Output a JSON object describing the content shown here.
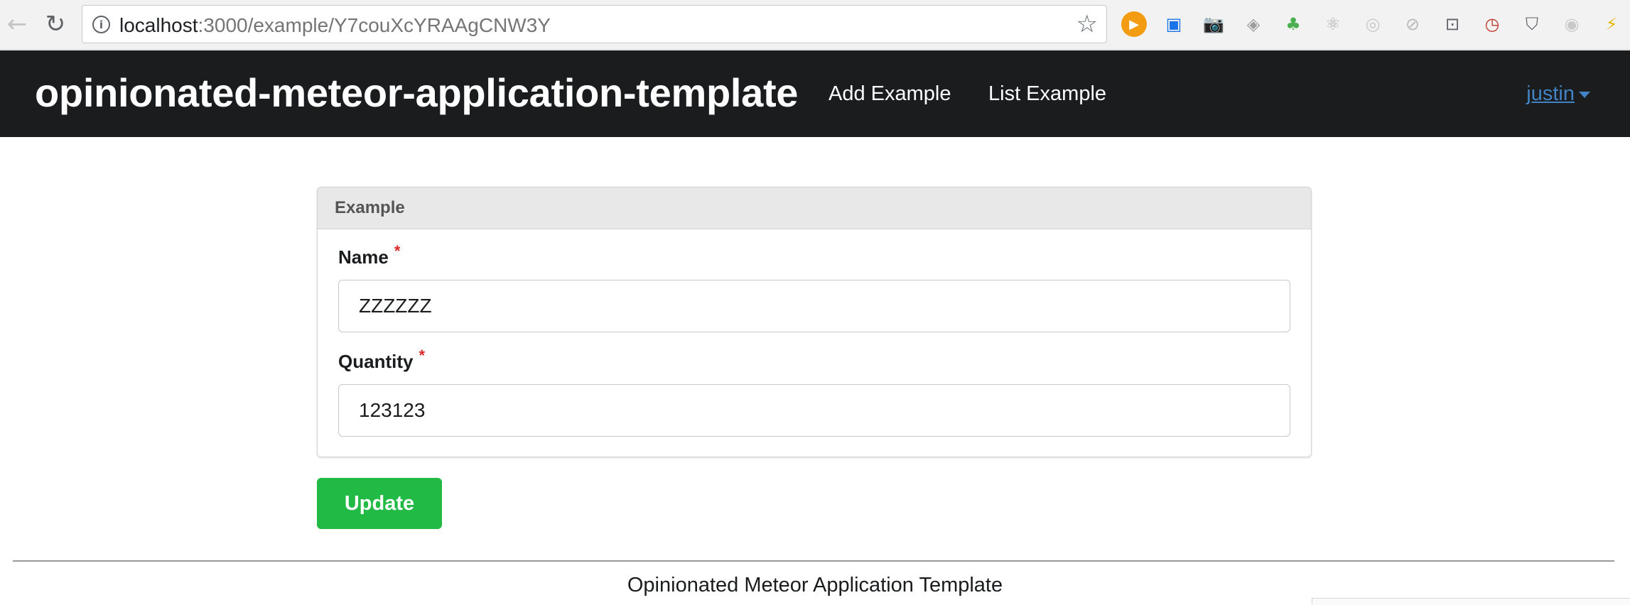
{
  "browser": {
    "url_host": "localhost",
    "url_path": ":3000/example/Y7couXcYRAAgCNW3Y",
    "icons": {
      "back": "←",
      "reload": "↻",
      "info": "i",
      "bookmark": "☆"
    },
    "extensions": [
      {
        "name": "extension-orange-play-icon",
        "glyph": "▶",
        "color": "#ffffff",
        "bg": "#f39c12"
      },
      {
        "name": "extension-blue-window-icon",
        "glyph": "▣",
        "color": "#1a73e8",
        "bg": "transparent"
      },
      {
        "name": "extension-camera-icon",
        "glyph": "📷",
        "color": "#8a8a8a",
        "bg": "transparent"
      },
      {
        "name": "extension-gray-shield-icon",
        "glyph": "◈",
        "color": "#9e9e9e",
        "bg": "transparent"
      },
      {
        "name": "extension-green-tree-icon",
        "glyph": "♣",
        "color": "#4caf50",
        "bg": "transparent"
      },
      {
        "name": "extension-react-atom-icon",
        "glyph": "⚛",
        "color": "#b0b0b0",
        "bg": "transparent"
      },
      {
        "name": "extension-gray-circle-icon",
        "glyph": "◎",
        "color": "#c8c8c8",
        "bg": "transparent"
      },
      {
        "name": "extension-no-entry-icon",
        "glyph": "⊘",
        "color": "#b8b8b8",
        "bg": "transparent"
      },
      {
        "name": "extension-cast-icon",
        "glyph": "⊡",
        "color": "#5f6368",
        "bg": "transparent"
      },
      {
        "name": "extension-red-clock-icon",
        "glyph": "◷",
        "color": "#c0392b",
        "bg": "transparent"
      },
      {
        "name": "extension-dark-shield-icon",
        "glyph": "⛉",
        "color": "#5f6368",
        "bg": "transparent"
      },
      {
        "name": "extension-ublock-icon",
        "glyph": "◉",
        "color": "#c8c8c8",
        "bg": "transparent"
      },
      {
        "name": "extension-yellow-edge-icon",
        "glyph": "⚡",
        "color": "#e6b800",
        "bg": "transparent"
      }
    ]
  },
  "navbar": {
    "brand": "opinionated-meteor-application-template",
    "links": {
      "add": "Add Example",
      "list": "List Example"
    },
    "user": "justin"
  },
  "form": {
    "header": "Example",
    "required_mark": "*",
    "name_label": "Name",
    "name_value": "ZZZZZZ",
    "quantity_label": "Quantity",
    "quantity_value": "123123",
    "submit_label": "Update"
  },
  "footer": {
    "text": "Opinionated Meteor Application Template"
  },
  "colors": {
    "navbar_bg": "#1b1c1d",
    "link_blue": "#4183c4",
    "button_green": "#21ba45",
    "required_red": "#db2828"
  }
}
